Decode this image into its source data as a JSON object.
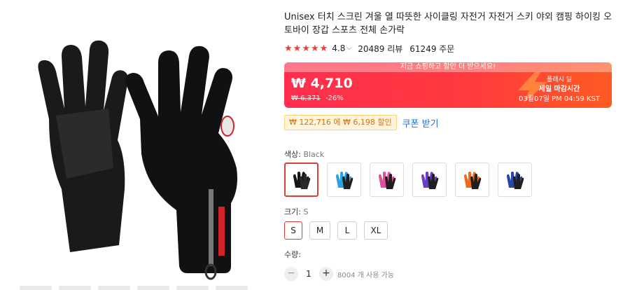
{
  "product": {
    "title": "Unisex 터치 스크린 겨울 열 따뜻한 사이클링 자전거 자전거 스키 야외 캠핑 하이킹 오토바이 장갑 스포츠 전체 손가락",
    "rating": "4.8",
    "reviews": "20489 리뷰",
    "orders": "61249 주문"
  },
  "price": {
    "banner": "지금 쇼핑하고 할인 더 받으세요!",
    "current": "₩ 4,710",
    "original": "₩ 6,371",
    "discount": "-26%",
    "flash_line1": "플래시 딜",
    "flash_line2": "세일 마감시간",
    "flash_line3": "03월07일 PM 04:59 KST"
  },
  "coupon": {
    "tag": "₩ 122,716 에 ₩ 6,198 할인",
    "link": "쿠폰 받기"
  },
  "color": {
    "label": "색상:",
    "selected": "Black",
    "options": [
      "Black",
      "Blue",
      "Pink",
      "Purple",
      "Orange",
      "Navy"
    ]
  },
  "size": {
    "label": "크기:",
    "selected": "S",
    "options": [
      "S",
      "M",
      "L",
      "XL"
    ]
  },
  "quantity": {
    "label": "수량:",
    "value": "1",
    "available": "8004 개 사용 가능",
    "minus": "−",
    "plus": "+"
  },
  "colors": {
    "accent_red": "#e23b3b",
    "star": "#f23a3c",
    "link": "#1f6fd8"
  }
}
